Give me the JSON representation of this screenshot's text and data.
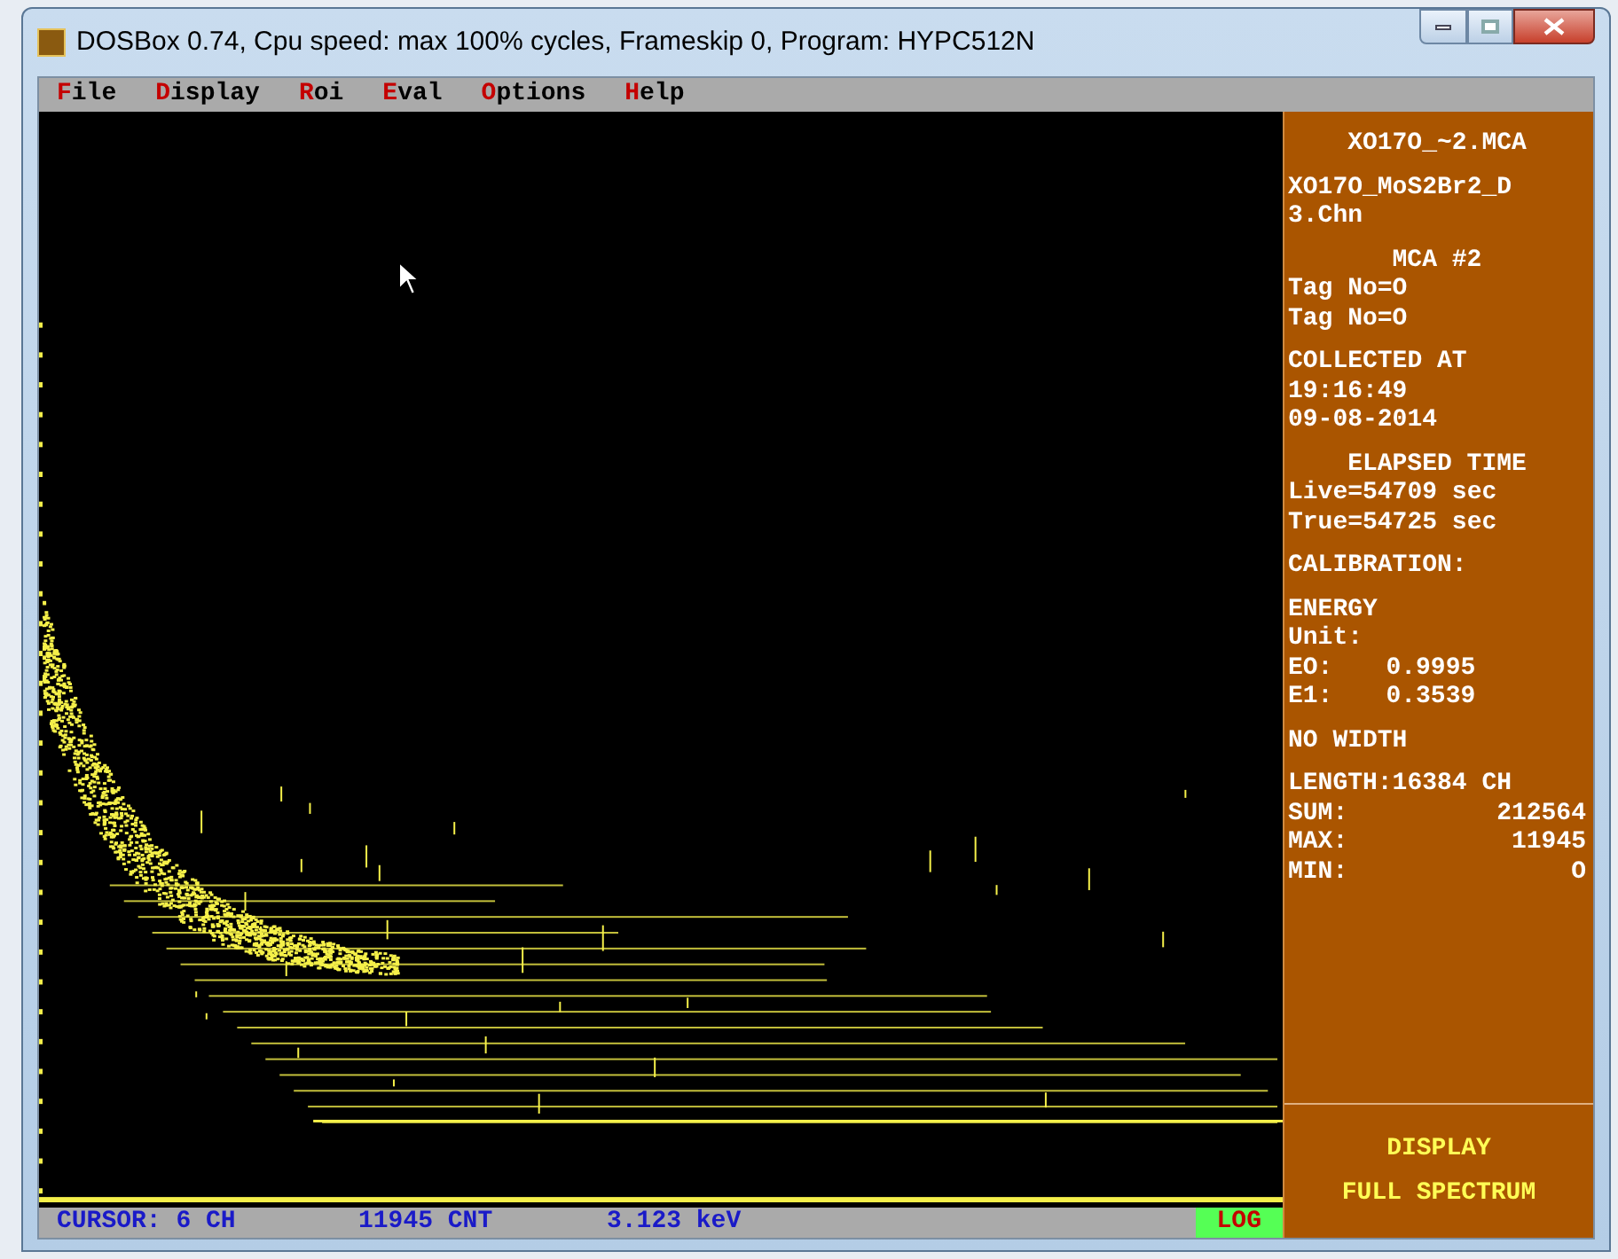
{
  "window": {
    "title": "DOSBox 0.74, Cpu speed: max 100% cycles, Frameskip  0, Program: HYPC512N"
  },
  "menu": [
    {
      "label": "File"
    },
    {
      "label": "Display"
    },
    {
      "label": "Roi"
    },
    {
      "label": "Eval"
    },
    {
      "label": "Options"
    },
    {
      "label": "Help"
    }
  ],
  "info_panel": {
    "blocks": [
      [
        {
          "kind": "center",
          "text": "XO17O_~2.MCA"
        }
      ],
      [
        {
          "kind": "line",
          "text": "XO17O_MoS2Br2_D"
        },
        {
          "kind": "line",
          "text": "3.Chn"
        }
      ],
      [
        {
          "kind": "center",
          "text": "MCA #2"
        },
        {
          "kind": "line",
          "text": "Tag No=O"
        },
        {
          "kind": "line",
          "text": "Tag No=O"
        }
      ],
      [
        {
          "kind": "line",
          "text": "COLLECTED AT"
        },
        {
          "kind": "line",
          "text": "19:16:49"
        },
        {
          "kind": "line",
          "text": "09-08-2014"
        }
      ],
      [
        {
          "kind": "center",
          "text": "ELAPSED TIME"
        },
        {
          "kind": "line",
          "text": "Live=54709 sec"
        },
        {
          "kind": "line",
          "text": "True=54725 sec"
        }
      ],
      [
        {
          "kind": "line",
          "text": "CALIBRATION:"
        }
      ],
      [
        {
          "kind": "line",
          "text": "ENERGY"
        },
        {
          "kind": "line",
          "text": "Unit:"
        },
        {
          "kind": "pair",
          "text": "EO:",
          "value": "0.9995"
        },
        {
          "kind": "pair",
          "text": "E1:",
          "value": "0.3539"
        }
      ],
      [
        {
          "kind": "line",
          "text": "NO WIDTH"
        }
      ],
      [
        {
          "kind": "line",
          "text": "LENGTH:16384 CH"
        },
        {
          "kind": "stat",
          "text": "SUM:",
          "value": "212564"
        },
        {
          "kind": "stat",
          "text": "MAX:",
          "value": "11945"
        },
        {
          "kind": "stat",
          "text": "MIN:",
          "value": "O"
        }
      ]
    ],
    "footer": [
      "DISPLAY",
      "FULL SPECTRUM"
    ]
  },
  "status_bar": {
    "cursor": "CURSOR: 6 CH",
    "count": "11945 CNT",
    "energy": "3.123 keV",
    "scale": "LOG"
  }
}
